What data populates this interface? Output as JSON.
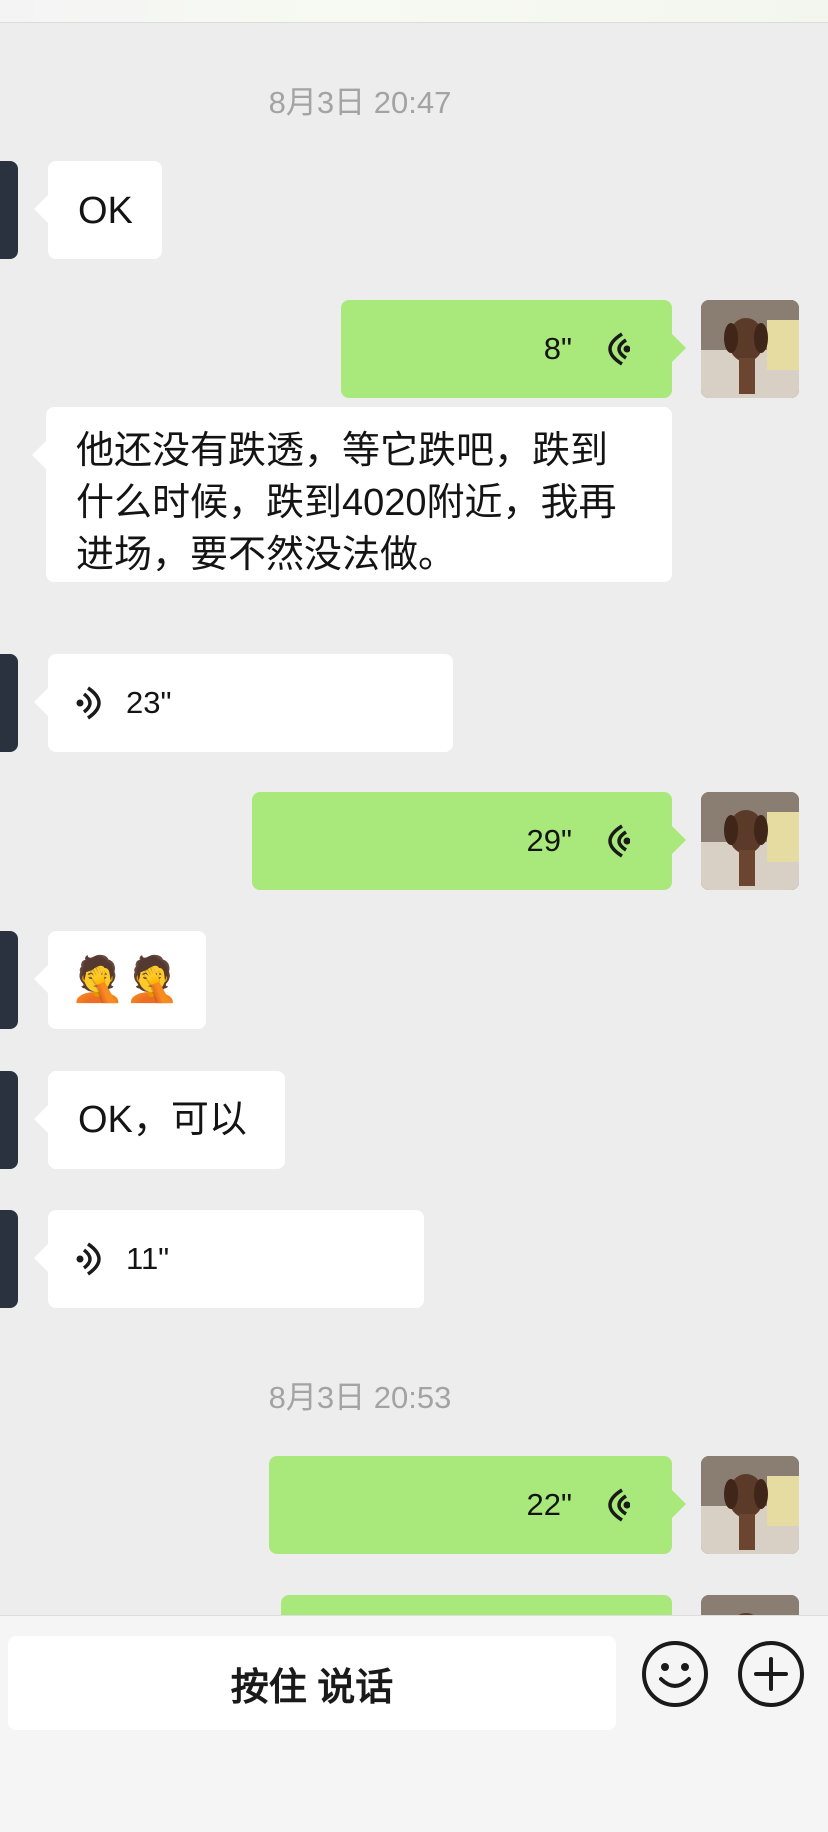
{
  "timestamps": [
    "8月3日 20:47",
    "8月3日 20:53"
  ],
  "messages": {
    "m1": {
      "text": "OK"
    },
    "m2": {
      "duration": "8\""
    },
    "m3": {
      "text": "他还没有跌透，等它跌吧，跌到什么时候，跌到4020附近，我再进场，要不然没法做。"
    },
    "m4": {
      "duration": "23\""
    },
    "m5": {
      "duration": "29\""
    },
    "m6": {
      "emoji": "🤦🤦"
    },
    "m7": {
      "text": "OK，可以"
    },
    "m8": {
      "duration": "11\""
    },
    "m9": {
      "duration": "22\""
    }
  },
  "input": {
    "hold_to_talk": "按住 说话"
  },
  "icons": {
    "emoji_button": "smiley-icon",
    "more_button": "plus-icon",
    "voice_in": "voice-wave-icon",
    "voice_out": "voice-wave-icon"
  },
  "colors": {
    "background": "#ededed",
    "outgoing_bubble": "#a9e87a",
    "incoming_bubble": "#ffffff",
    "timestamp": "#a3a3a3"
  }
}
